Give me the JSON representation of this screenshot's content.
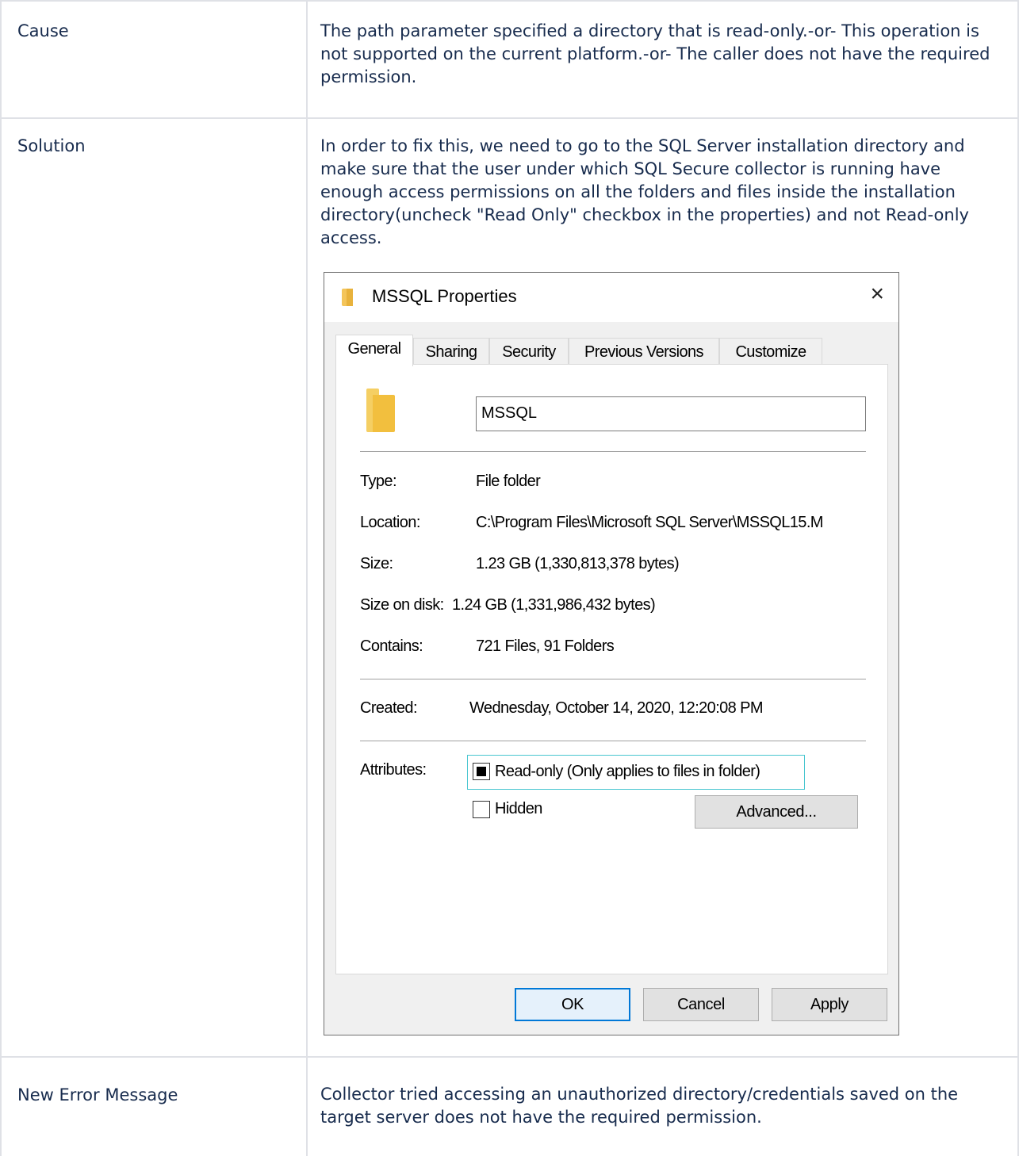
{
  "rows": [
    {
      "label": "Cause",
      "value": "The path parameter specified a directory that is read-only.-or- This operation is not supported on the current platform.-or- The caller does not have the required permission."
    },
    {
      "label": "Solution",
      "value": "In order to fix this, we need to go to the SQL Server installation directory and make sure that the user under which SQL Secure collector is running have enough access permissions on all the folders and files inside the installation directory(uncheck \"Read Only\" checkbox in the properties) and not Read-only access."
    },
    {
      "label": "New Error Message",
      "value": "Collector tried accessing an unauthorized directory/credentials saved on the target server does not have the required permission."
    }
  ],
  "dialog": {
    "title": "MSSQL Properties",
    "close": "×",
    "tabs": [
      "General",
      "Sharing",
      "Security",
      "Previous Versions",
      "Customize"
    ],
    "folder_name": "MSSQL",
    "properties": [
      {
        "label": "Type:",
        "value": "File folder"
      },
      {
        "label": "Location:",
        "value": "C:\\Program Files\\Microsoft SQL Server\\MSSQL15.M"
      },
      {
        "label": "Size:",
        "value": "1.23 GB (1,330,813,378 bytes)"
      },
      {
        "label": "Size on disk:",
        "value": "1.24 GB (1,331,986,432 bytes)"
      },
      {
        "label": "Contains:",
        "value": "721 Files, 91 Folders"
      }
    ],
    "created_label": "Created:",
    "created_value": "Wednesday, October 14, 2020, 12:20:08 PM",
    "attributes_label": "Attributes:",
    "readonly_label": "Read-only (Only applies to files in folder)",
    "readonly_state": "indeterminate",
    "hidden_label": "Hidden",
    "hidden_checked": false,
    "advanced_button": "Advanced...",
    "ok_button": "OK",
    "cancel_button": "Cancel",
    "apply_button": "Apply"
  }
}
